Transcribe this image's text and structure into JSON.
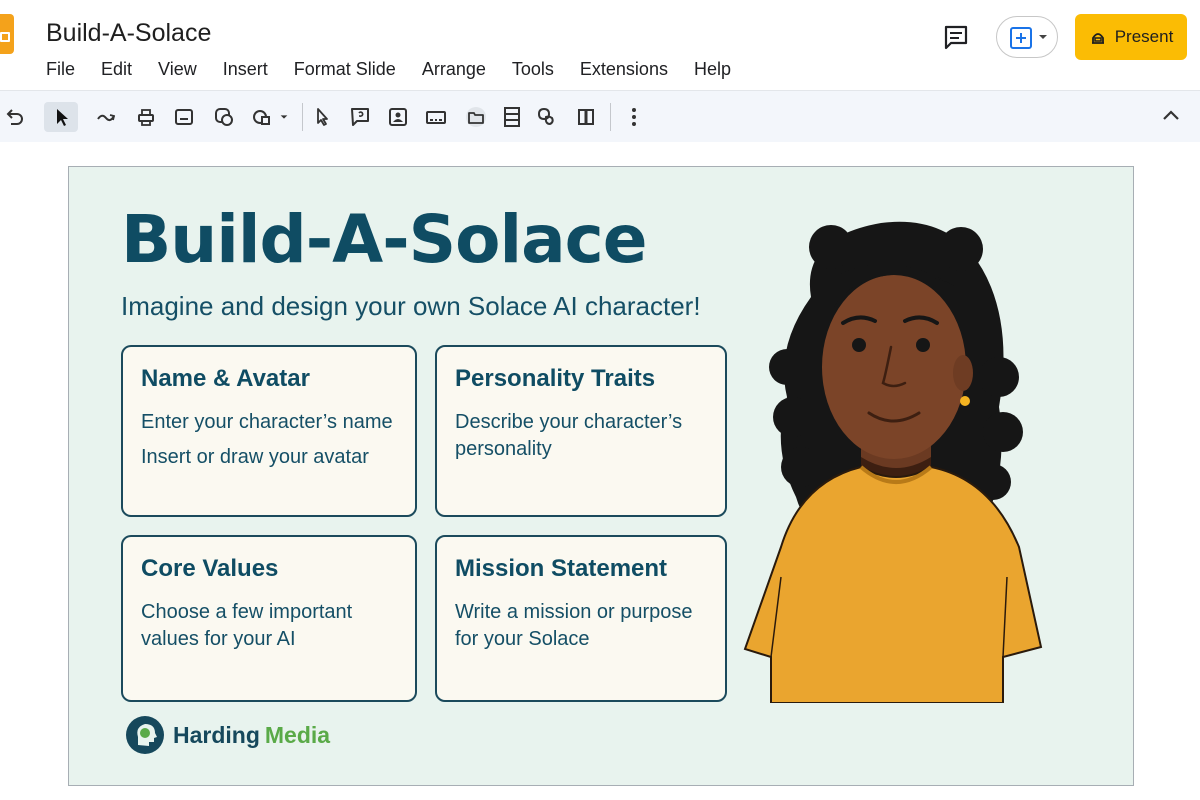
{
  "header": {
    "doc_title": "Build-A-Solace",
    "menu": [
      "File",
      "Edit",
      "View",
      "Insert",
      "Format Slide",
      "Arrange",
      "Tools",
      "Extensions",
      "Help"
    ],
    "present_label": "Present"
  },
  "toolbar": {
    "tools": [
      "undo-icon",
      "select-icon",
      "redo-icon",
      "paint-format-icon",
      "text-box-icon",
      "image-icon",
      "shape-icon",
      "pointer-icon",
      "comment-box-icon",
      "picture-icon",
      "layout-icon",
      "folder-icon",
      "column-icon",
      "shape-outline-icon",
      "border-icon",
      "more-icon"
    ]
  },
  "slide": {
    "title": "Build-A-Solace",
    "subtitle": "Imagine and design your own Solace AI character!",
    "cards": [
      {
        "title": "Name & Avatar",
        "lines": [
          "Enter your character’s name",
          "Insert or draw your avatar"
        ]
      },
      {
        "title": "Personality Traits",
        "lines": [
          "Describe your character’s personality"
        ]
      },
      {
        "title": "Core Values",
        "lines": [
          "Choose a few important values for your AI"
        ]
      },
      {
        "title": "Mission Statement",
        "lines": [
          "Write a mission or purpose for your Solace"
        ]
      }
    ],
    "brand": {
      "word1": "Harding",
      "word2": "Media"
    }
  },
  "colors": {
    "slide_bg": "#e8f3ee",
    "title": "#0f4c63",
    "card_bg": "#fbf9f1",
    "card_border": "#1b4a5c",
    "present_button": "#fbbc04",
    "brand_green": "#5aaa48",
    "shirt": "#eaa52f"
  }
}
